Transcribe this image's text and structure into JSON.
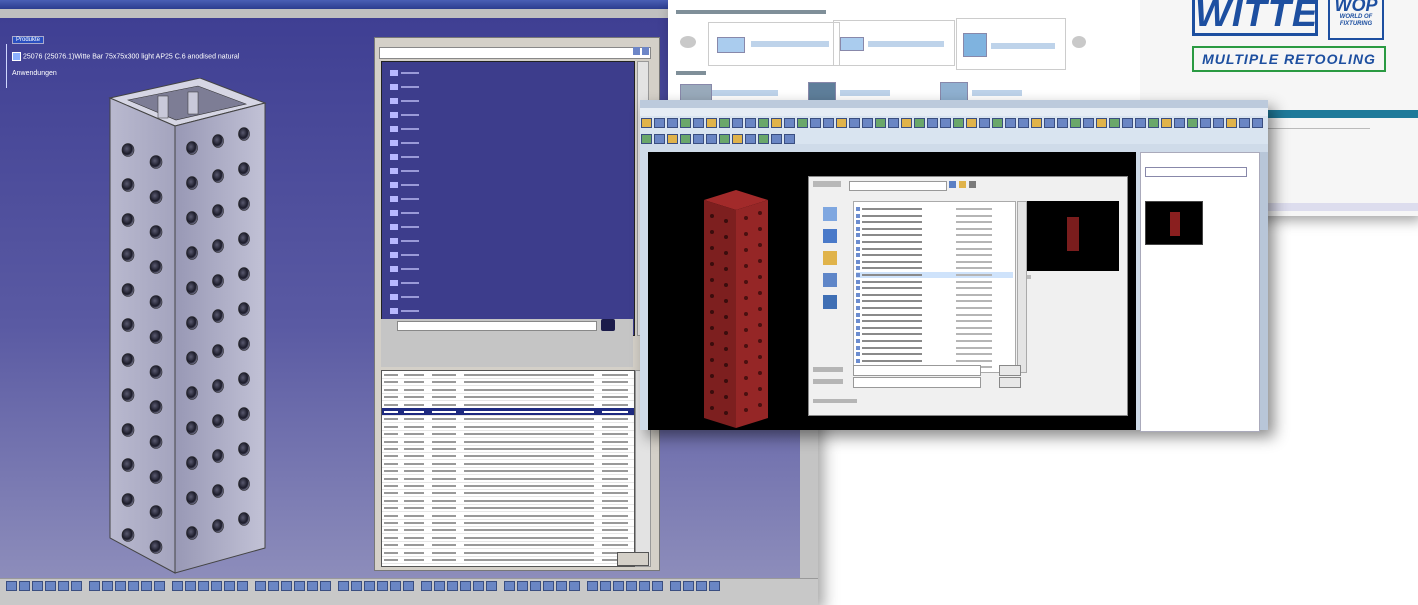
{
  "catia": {
    "tree_root": "Produkte",
    "product_line": "25076 (25076.1)Witte Bar 75x75x300 light AP25 C.6 anodised natural",
    "applications_line": "Anwendungen"
  },
  "web": {
    "logo": "WITTE",
    "wop_logo": "WOP",
    "wop_subline": "WORLD OF FIXTURING",
    "retooling": "MULTIPLE RETOOLING"
  },
  "colors": {
    "catia_bg": "#3d3d8c",
    "witte_blue": "#1d4fa0",
    "retooling_green": "#2a9a42",
    "selection_blue": "#1e2a80",
    "cube_red": "#8a1f1f"
  }
}
